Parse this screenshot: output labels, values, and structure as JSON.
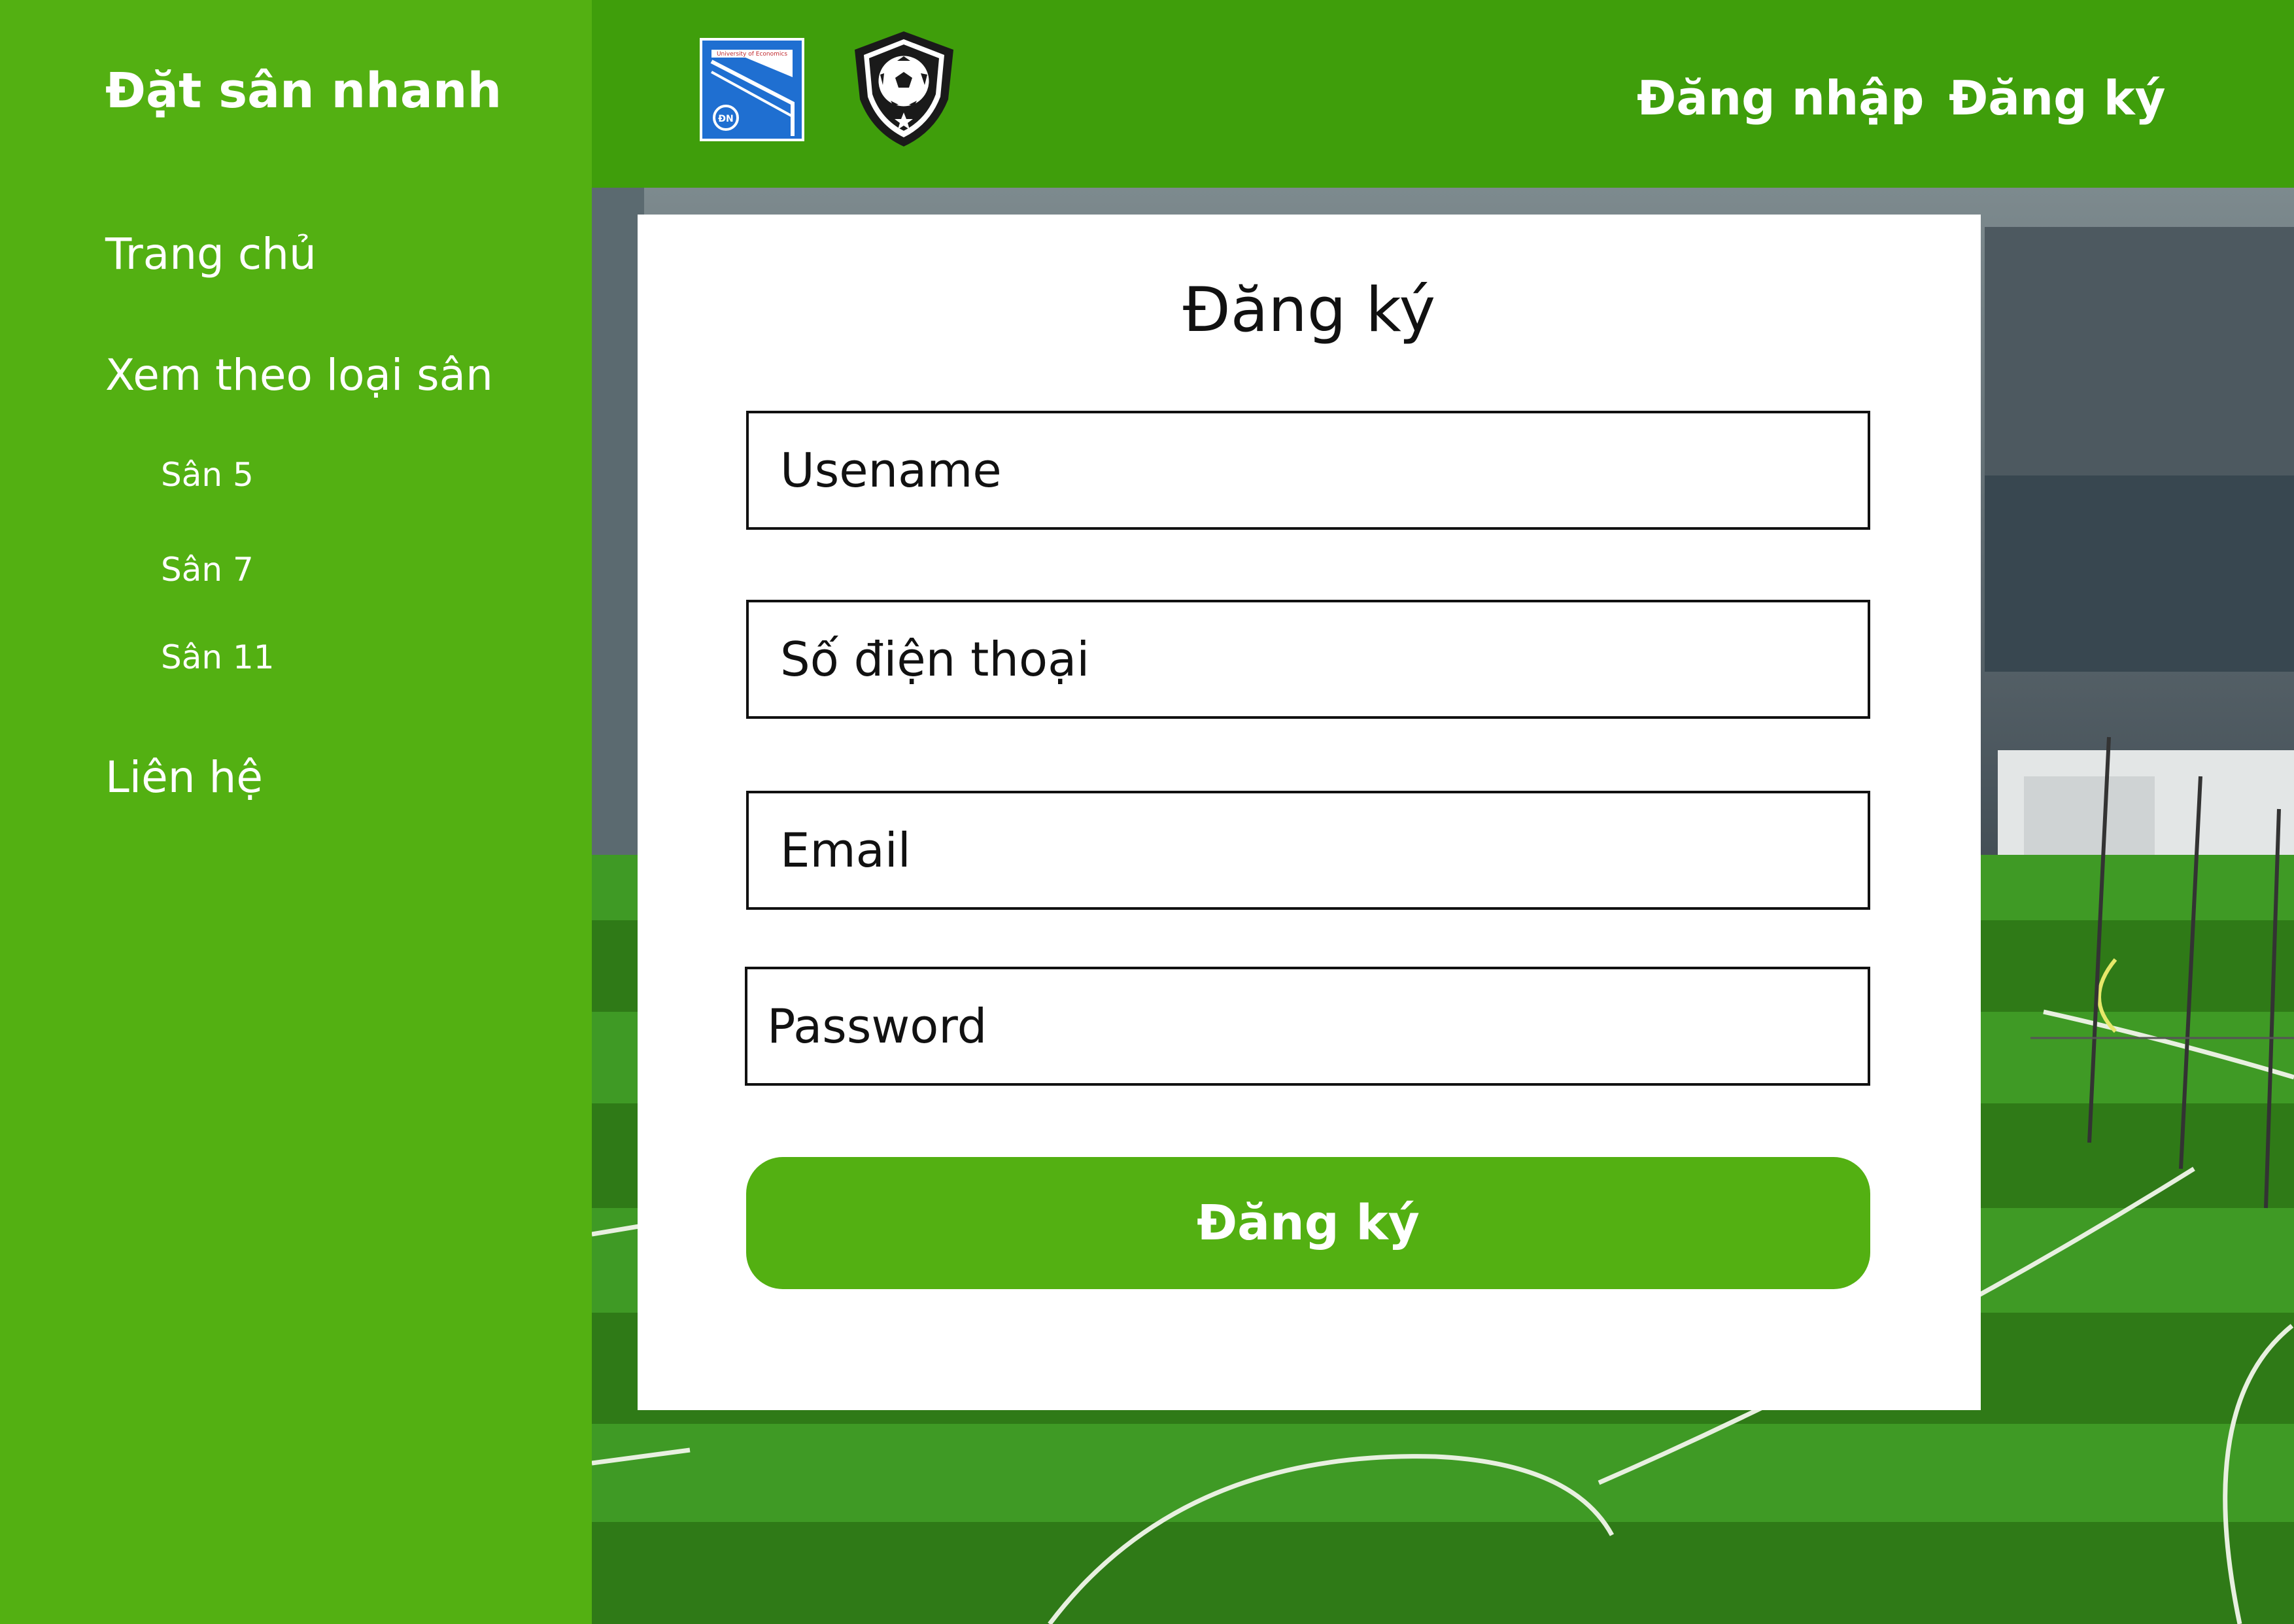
{
  "sidebar": {
    "brand": "Đặt sân nhanh",
    "home": "Trang chủ",
    "by_type": "Xem theo loại sân",
    "sub_items": [
      "Sân 5",
      "Sân 7",
      "Sân 11"
    ],
    "contact": "Liên hệ"
  },
  "header": {
    "login": "Đăng nhập",
    "register": "Đăng ký",
    "logos": [
      "university-of-economics-logo",
      "soccer-ball-shield-logo"
    ],
    "uni_logo_text": "University of Economics"
  },
  "form": {
    "title": "Đăng ký",
    "username_placeholder": "Usename",
    "phone_placeholder": "Số điện thoại",
    "email_placeholder": "Email",
    "password_placeholder": "Password",
    "submit": "Đăng ký"
  },
  "colors": {
    "sidebar": "#53b012",
    "header": "#3f9e0b",
    "button": "#53b012"
  }
}
